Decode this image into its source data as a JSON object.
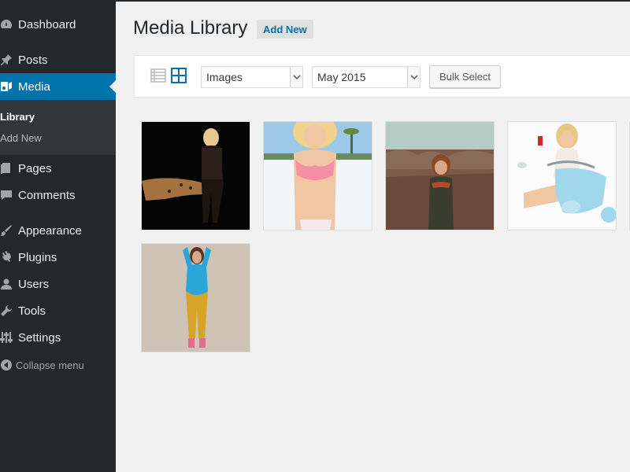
{
  "sidebar": {
    "items": [
      {
        "label": "Dashboard",
        "icon": "dashboard-icon"
      },
      {
        "label": "Posts",
        "icon": "pin-icon"
      },
      {
        "label": "Media",
        "icon": "media-icon"
      },
      {
        "label": "Pages",
        "icon": "pages-icon"
      },
      {
        "label": "Comments",
        "icon": "comment-icon"
      },
      {
        "label": "Appearance",
        "icon": "brush-icon"
      },
      {
        "label": "Plugins",
        "icon": "plug-icon"
      },
      {
        "label": "Users",
        "icon": "user-icon"
      },
      {
        "label": "Tools",
        "icon": "wrench-icon"
      },
      {
        "label": "Settings",
        "icon": "sliders-icon"
      }
    ],
    "submenu": [
      {
        "label": "Library"
      },
      {
        "label": "Add New"
      }
    ],
    "collapse_label": "Collapse menu"
  },
  "header": {
    "title": "Media Library",
    "add_new_label": "Add New"
  },
  "toolbar": {
    "type_filter": "Images",
    "date_filter": "May 2015",
    "bulk_select_label": "Bulk Select"
  },
  "colors": {
    "sidebar_bg": "#23282d",
    "active_bg": "#0073aa",
    "page_bg": "#f1f1f1",
    "link_blue": "#0073aa"
  }
}
